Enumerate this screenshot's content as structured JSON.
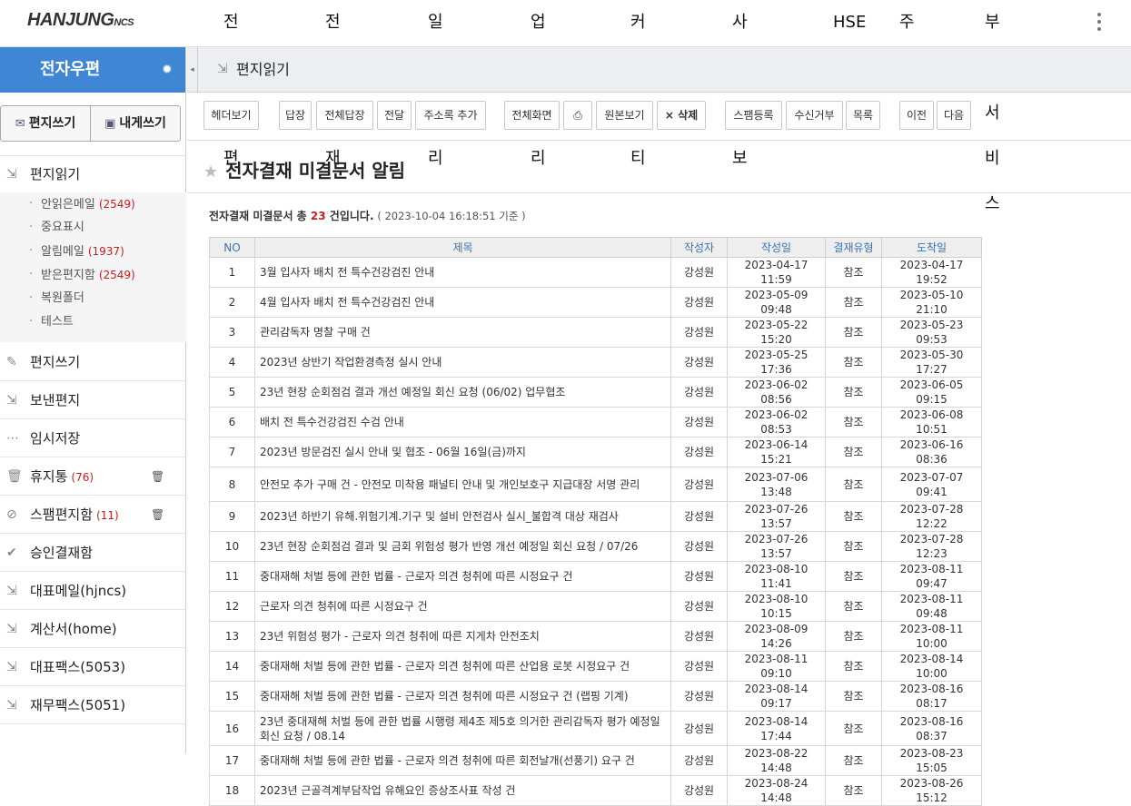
{
  "logo": {
    "main": "HANJUNG",
    "sub": "NCS"
  },
  "topnav": [
    "전자우편",
    "전자결재",
    "일정관리",
    "업무관리",
    "커뮤니티",
    "사내정보",
    "HSE",
    "주소록",
    "부가서비스"
  ],
  "sidebar": {
    "title": "전자우편",
    "write_label": "편지쓰기",
    "self_label": "내게쓰기",
    "read_label": "편지읽기",
    "sub": [
      {
        "label": "안읽은메일",
        "count": "(2549)"
      },
      {
        "label": "중요표시",
        "count": ""
      },
      {
        "label": "알림메일",
        "count": "(1937)"
      },
      {
        "label": "받은편지함",
        "count": "(2549)"
      },
      {
        "label": "복원폴더",
        "count": ""
      },
      {
        "label": "테스트",
        "count": ""
      }
    ],
    "menu": [
      {
        "label": "편지쓰기",
        "count": "",
        "icon": "pencil-icon"
      },
      {
        "label": "보낸편지",
        "count": "",
        "icon": "sent-icon"
      },
      {
        "label": "임시저장",
        "count": "",
        "icon": "draft-icon"
      },
      {
        "label": "휴지통",
        "count": "(76)",
        "icon": "trash-icon"
      },
      {
        "label": "스팸편지함",
        "count": "(11)",
        "icon": "block-icon"
      },
      {
        "label": "승인결재함",
        "count": "",
        "icon": "approve-icon"
      },
      {
        "label": "대표메일(hjncs)",
        "count": "",
        "icon": "mail-icon"
      },
      {
        "label": "계산서(home)",
        "count": "",
        "icon": "mail-icon"
      },
      {
        "label": "대표팩스(5053)",
        "count": "",
        "icon": "fax-icon"
      },
      {
        "label": "재무팩스(5051)",
        "count": "",
        "icon": "fax-icon"
      }
    ]
  },
  "crumb": "편지읽기",
  "toolbar": [
    "헤더보기",
    "답장",
    "전체답장",
    "전달",
    "주소록 추가",
    "전체화면",
    "원본보기",
    "삭제",
    "스팸등록",
    "수신거부",
    "목록",
    "이전",
    "다음"
  ],
  "mail": {
    "title": "전자결재 미결문서 알림",
    "summary_prefix": "전자결재 미결문서 총 ",
    "count": "23",
    "summary_suffix": " 건입니다.",
    "timestamp": "( 2023-10-04 16:18:51 기준 )"
  },
  "table": {
    "headers": [
      "NO",
      "제목",
      "작성자",
      "작성일",
      "결재유형",
      "도착일"
    ],
    "rows": [
      [
        "1",
        "3월 입사자 배치 전 특수건강검진 안내",
        "강성원",
        "2023-04-17 11:59",
        "참조",
        "2023-04-17 19:52"
      ],
      [
        "2",
        "4월 입사자 배치 전 특수건강검진 안내",
        "강성원",
        "2023-05-09 09:48",
        "참조",
        "2023-05-10 21:10"
      ],
      [
        "3",
        "관리감독자 명찰 구매 건",
        "강성원",
        "2023-05-22 15:20",
        "참조",
        "2023-05-23 09:53"
      ],
      [
        "4",
        "2023년 상반기 작업환경측정 실시 안내",
        "강성원",
        "2023-05-25 17:36",
        "참조",
        "2023-05-30 17:27"
      ],
      [
        "5",
        "23년 현장 순회점검 결과 개선 예정일 회신 요청 (06/02) 업무협조",
        "강성원",
        "2023-06-02 08:56",
        "참조",
        "2023-06-05 09:15"
      ],
      [
        "6",
        "배치 전 특수건강검진 수검 안내",
        "강성원",
        "2023-06-02 08:53",
        "참조",
        "2023-06-08 10:51"
      ],
      [
        "7",
        "2023년 방문검진 실시 안내 및 협조 - 06월 16일(금)까지",
        "강성원",
        "2023-06-14 15:21",
        "참조",
        "2023-06-16 08:36"
      ],
      [
        "8",
        "안전모 추가 구매 건 - 안전모 미착용 패널티 안내 및 개인보호구 지급대장 서명 관리",
        "강성원",
        "2023-07-06 13:48",
        "참조",
        "2023-07-07 09:41"
      ],
      [
        "9",
        "2023년 하반기 유해.위험기계.기구 및 설비 안전검사 실시_불합격 대상 재검사",
        "강성원",
        "2023-07-26 13:57",
        "참조",
        "2023-07-28 12:22"
      ],
      [
        "10",
        "23년 현장 순회점검 결과 및 금회 위험성 평가 반영 개선 예정일 회신 요청 / 07/26",
        "강성원",
        "2023-07-26 13:57",
        "참조",
        "2023-07-28 12:23"
      ],
      [
        "11",
        "중대재해 처벌 등에 관한 법률 - 근로자 의견 청취에 따른 시정요구 건",
        "강성원",
        "2023-08-10 11:41",
        "참조",
        "2023-08-11 09:47"
      ],
      [
        "12",
        "근로자 의견 청취에 따른 시정요구 건",
        "강성원",
        "2023-08-10 10:15",
        "참조",
        "2023-08-11 09:48"
      ],
      [
        "13",
        "23년 위험성 평가 - 근로자 의견 청취에 따른 지게차 안전조치",
        "강성원",
        "2023-08-09 14:26",
        "참조",
        "2023-08-11 10:00"
      ],
      [
        "14",
        "중대재해 처벌 등에 관한 법률 - 근로자 의견 청취에 따른 산업용 로봇 시정요구 건",
        "강성원",
        "2023-08-11 09:10",
        "참조",
        "2023-08-14 10:00"
      ],
      [
        "15",
        "중대재해 처벌 등에 관한 법률 - 근로자 의견 청취에 따른 시정요구 건 (랩핑 기계)",
        "강성원",
        "2023-08-14 09:17",
        "참조",
        "2023-08-16 08:17"
      ],
      [
        "16",
        "23년 중대재해 처벌 등에 관한 법률 시행령 제4조 제5호 의거한 관리감독자 평가 예정일 회신 요청 / 08.14",
        "강성원",
        "2023-08-14 17:44",
        "참조",
        "2023-08-16 08:37"
      ],
      [
        "17",
        "중대재해 처벌 등에 관한 법률 - 근로자 의견 청취에 따른 회전날개(선풍기) 요구 건",
        "강성원",
        "2023-08-22 14:48",
        "참조",
        "2023-08-23 15:05"
      ],
      [
        "18",
        "2023년 근골격계부담작업 유해요인 증상조사표 작성 건",
        "강성원",
        "2023-08-24 14:48",
        "참조",
        "2023-08-26 15:12"
      ]
    ]
  }
}
